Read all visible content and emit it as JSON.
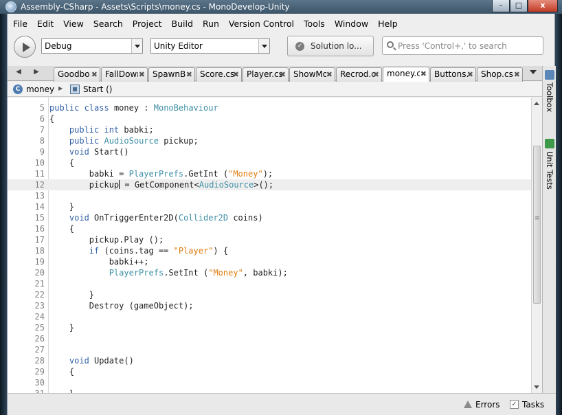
{
  "window": {
    "title": "Assembly-CSharp - Assets\\Scripts\\money.cs - MonoDevelop-Unity",
    "controls": {
      "minimize": "–",
      "maximize": "□",
      "close": "x"
    }
  },
  "menu": [
    "File",
    "Edit",
    "View",
    "Search",
    "Project",
    "Build",
    "Run",
    "Version Control",
    "Tools",
    "Window",
    "Help"
  ],
  "toolbar": {
    "config": "Debug",
    "target": "Unity Editor",
    "status": "Solution lo...",
    "search_placeholder": "Press 'Control+,' to search"
  },
  "tabs": [
    {
      "label": "Goodbo"
    },
    {
      "label": "FallDowr"
    },
    {
      "label": "SpawnBc"
    },
    {
      "label": "Score.cs"
    },
    {
      "label": "Player.cs"
    },
    {
      "label": "ShowMo"
    },
    {
      "label": "Recrod.c"
    },
    {
      "label": "money.cs",
      "active": true
    },
    {
      "label": "Buttons."
    },
    {
      "label": "Shop.cs"
    }
  ],
  "breadcrumb": {
    "class_name": "money",
    "method_name": "Start ()"
  },
  "code_lines": [
    {
      "n": "5",
      "tokens": [
        [
          "kw",
          "public"
        ],
        [
          "",
          ""
        ],
        [
          "kw",
          " class"
        ],
        [
          "",
          " money : "
        ],
        [
          "ty",
          "MonoBehaviour"
        ]
      ]
    },
    {
      "n": "6",
      "tokens": [
        [
          "",
          "{"
        ]
      ]
    },
    {
      "n": "7",
      "tokens": [
        [
          "",
          "    "
        ],
        [
          "kw",
          "public int"
        ],
        [
          "",
          " babki;"
        ]
      ]
    },
    {
      "n": "8",
      "tokens": [
        [
          "",
          "    "
        ],
        [
          "kw",
          "public"
        ],
        [
          "",
          " "
        ],
        [
          "ty",
          "AudioSource"
        ],
        [
          "",
          " pickup;"
        ]
      ]
    },
    {
      "n": "9",
      "tokens": [
        [
          "",
          "    "
        ],
        [
          "kw",
          "void"
        ],
        [
          "",
          " Start()"
        ]
      ]
    },
    {
      "n": "10",
      "tokens": [
        [
          "",
          "    {"
        ]
      ]
    },
    {
      "n": "11",
      "tokens": [
        [
          "",
          "        babki = "
        ],
        [
          "ty",
          "PlayerPrefs"
        ],
        [
          "",
          ".GetInt ("
        ],
        [
          "str",
          "\"Money\""
        ],
        [
          "",
          ");"
        ]
      ]
    },
    {
      "n": "12",
      "current": true,
      "tokens": [
        [
          "",
          "        pickup"
        ],
        [
          "caret",
          ""
        ],
        [
          "",
          " = GetComponent<"
        ],
        [
          "ty",
          "AudioSource"
        ],
        [
          "",
          ">();"
        ]
      ]
    },
    {
      "n": "13",
      "tokens": []
    },
    {
      "n": "14",
      "tokens": [
        [
          "",
          "    }"
        ]
      ]
    },
    {
      "n": "15",
      "tokens": [
        [
          "",
          "    "
        ],
        [
          "kw",
          "void"
        ],
        [
          "",
          " OnTriggerEnter2D("
        ],
        [
          "ty",
          "Collider2D"
        ],
        [
          "",
          " coins)"
        ]
      ]
    },
    {
      "n": "16",
      "tokens": [
        [
          "",
          "    {"
        ]
      ]
    },
    {
      "n": "17",
      "tokens": [
        [
          "",
          "        pickup.Play ();"
        ]
      ]
    },
    {
      "n": "18",
      "tokens": [
        [
          "",
          "        "
        ],
        [
          "kw",
          "if"
        ],
        [
          "",
          " (coins.tag == "
        ],
        [
          "str",
          "\"Player\""
        ],
        [
          "",
          ") {"
        ]
      ]
    },
    {
      "n": "19",
      "tokens": [
        [
          "",
          "            babki++;"
        ]
      ]
    },
    {
      "n": "20",
      "tokens": [
        [
          "",
          "            "
        ],
        [
          "ty",
          "PlayerPrefs"
        ],
        [
          "",
          ".SetInt ("
        ],
        [
          "str",
          "\"Money\""
        ],
        [
          "",
          ", babki);"
        ]
      ]
    },
    {
      "n": "21",
      "tokens": []
    },
    {
      "n": "22",
      "tokens": [
        [
          "",
          "        }"
        ]
      ]
    },
    {
      "n": "23",
      "tokens": [
        [
          "",
          "        Destroy (gameObject);"
        ]
      ]
    },
    {
      "n": "24",
      "tokens": []
    },
    {
      "n": "25",
      "tokens": [
        [
          "",
          "    }"
        ]
      ]
    },
    {
      "n": "26",
      "tokens": []
    },
    {
      "n": "27",
      "tokens": []
    },
    {
      "n": "28",
      "tokens": [
        [
          "",
          "    "
        ],
        [
          "kw",
          "void"
        ],
        [
          "",
          " Update()"
        ]
      ]
    },
    {
      "n": "29",
      "tokens": [
        [
          "",
          "    {"
        ]
      ]
    },
    {
      "n": "30",
      "tokens": []
    },
    {
      "n": "31",
      "tokens": [
        [
          "",
          "    }"
        ]
      ]
    }
  ],
  "dock": {
    "toolbox": "Toolbox",
    "unit_tests": "Unit Tests"
  },
  "statusbar": {
    "errors": "Errors",
    "tasks": "Tasks"
  },
  "icons": {
    "app": "monodevelop-icon",
    "run": "play-icon",
    "status": "check-circle-icon",
    "search": "search-icon",
    "class": "class-icon",
    "method": "method-icon",
    "errors": "warning-icon",
    "tasks": "checkbox-icon"
  },
  "colors": {
    "keyword": "#3361a8",
    "type": "#3f8fa6",
    "string": "#e07d10",
    "titlebar": "#4a6175"
  }
}
